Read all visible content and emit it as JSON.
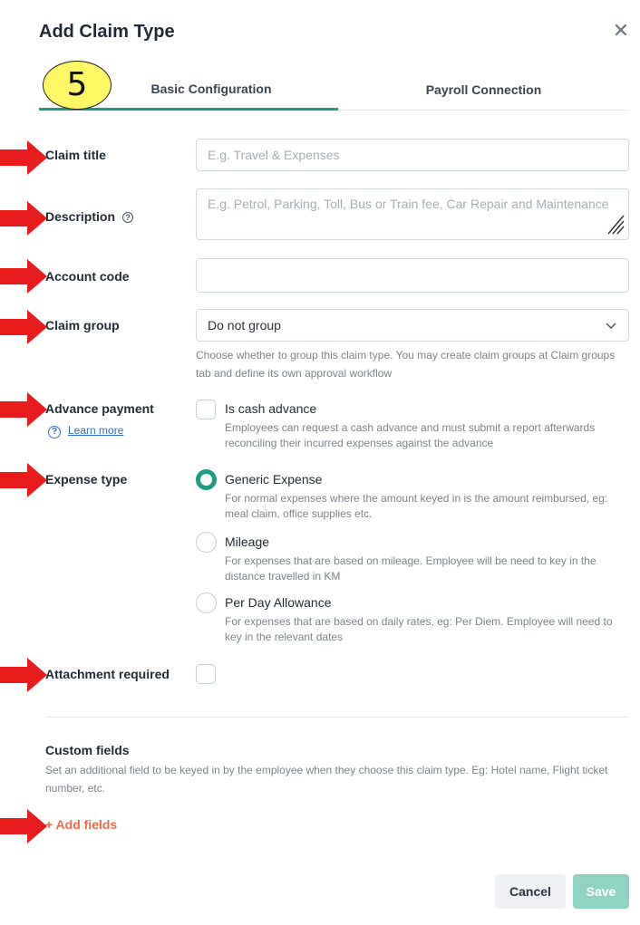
{
  "dialog": {
    "title": "Add Claim Type",
    "close_icon": "close-icon"
  },
  "step_badge": "5",
  "tabs": [
    {
      "label": "Basic Configuration",
      "active": true
    },
    {
      "label": "Payroll Connection",
      "active": false
    }
  ],
  "fields": {
    "claim_title": {
      "label": "Claim title",
      "placeholder": "E.g. Travel & Expenses",
      "value": ""
    },
    "description": {
      "label": "Description",
      "placeholder": "E.g. Petrol, Parking, Toll, Bus or Train fee, Car Repair and Maintenance",
      "value": ""
    },
    "account_code": {
      "label": "Account code",
      "value": ""
    },
    "claim_group": {
      "label": "Claim group",
      "selected": "Do not group",
      "hint": "Choose whether to group this claim type. You may create claim groups at Claim groups tab and define its own approval workflow"
    },
    "advance_payment": {
      "label": "Advance payment",
      "learn_more": "Learn more",
      "option_title": "Is cash advance",
      "option_desc": "Employees can request a cash advance and must submit a report afterwards reconciling their incurred expenses against the advance",
      "checked": false
    },
    "expense_type": {
      "label": "Expense type",
      "options": [
        {
          "title": "Generic Expense",
          "desc": "For normal expenses where the amount keyed in is the amount reimbursed, eg: meal claim, office supplies etc.",
          "checked": true
        },
        {
          "title": "Mileage",
          "desc": "For expenses that are based on mileage. Employee will be need to key in the distance travelled in KM",
          "checked": false
        },
        {
          "title": "Per Day Allowance",
          "desc": "For expenses that are based on daily rates, eg: Per Diem. Employee will need to key in the relevant dates",
          "checked": false
        }
      ]
    },
    "attachment_required": {
      "label": "Attachment required",
      "checked": false
    }
  },
  "custom_fields": {
    "title": "Custom fields",
    "desc": "Set an additional field to be keyed in by the employee when they choose this claim type. Eg: Hotel name, Flight ticket number, etc.",
    "add_label": "+ Add fields"
  },
  "footer": {
    "cancel_label": "Cancel",
    "save_label": "Save"
  },
  "colors": {
    "accent": "#1e9b82",
    "link": "#2f6fc7",
    "add_fields": "#f06a4a",
    "save_disabled": "#8fd3c3",
    "annotation_arrow": "#e81c1c",
    "badge": "#fff866"
  }
}
